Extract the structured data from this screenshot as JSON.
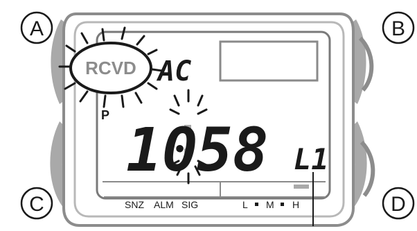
{
  "buttons": {
    "a": "A",
    "b": "B",
    "c": "C",
    "d": "D"
  },
  "display": {
    "badge": "RCVD",
    "pm_indicator": "P",
    "weekday": "AC",
    "time_hour": "10",
    "time_minute": "58",
    "signal_level": "L1"
  },
  "indicators": {
    "snz": "SNZ",
    "alm": "ALM",
    "sig": "SIG",
    "l": "L",
    "m": "M",
    "h": "H"
  },
  "style": {
    "ink": "#1a1a1a",
    "case_gray": "#a9a9a9",
    "case_dark": "#8c8c8c",
    "case_light": "#d8d8d8"
  }
}
